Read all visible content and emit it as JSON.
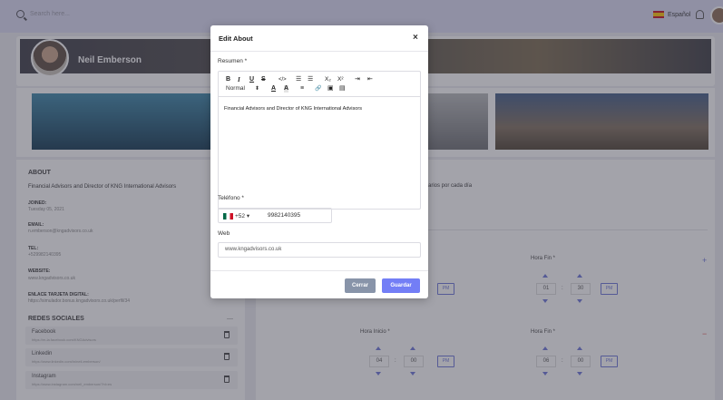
{
  "topbar": {
    "search_placeholder": "Search here...",
    "language": "Español"
  },
  "profile": {
    "name": "Neil Emberson"
  },
  "about": {
    "title": "ABOUT",
    "description": "Financial Advisors and Director of KNG International Advisors",
    "fields": [
      {
        "label": "JOINED:",
        "value": "Tuesday 05, 2021"
      },
      {
        "label": "EMAIL:",
        "value": "n.emberson@kngadvisors.co.uk"
      },
      {
        "label": "TEL:",
        "value": "+529982140395"
      },
      {
        "label": "WEBSITE:",
        "value": "www.kngadvisors.co.uk"
      },
      {
        "label": "ENLACE TARJETA DIGITAL:",
        "value": "https://simulador.bonus.kngadvisors.co.uk/perfil/34"
      }
    ],
    "social_title": "REDES SOCIALES",
    "social_more": "—",
    "social": [
      {
        "name": "Facebook",
        "url": "https://m-la.facebook.com/KNGAdvisors"
      },
      {
        "name": "Linkedin",
        "url": "https://www.linkedin.com/in/neil-emberson/"
      },
      {
        "name": "Instagram",
        "url": "https://www.instagram.com/neil_emberson/?hl=es"
      }
    ]
  },
  "hours": {
    "partial_text": "rarios por cada día",
    "rows": [
      {
        "start_label": "",
        "start_hour": "",
        "start_min": "",
        "start_ampm": "PM",
        "end_label": "Hora Fin *",
        "end_hour": "01",
        "end_min": "30",
        "end_ampm": "PM",
        "action": "+"
      },
      {
        "start_label": "Hora Inicio *",
        "start_hour": "04",
        "start_min": "00",
        "start_ampm": "PM",
        "end_label": "Hora Fin *",
        "end_hour": "06",
        "end_min": "00",
        "end_ampm": "PM",
        "action": "−"
      }
    ]
  },
  "modal": {
    "title": "Edit About",
    "close": "×",
    "resumen_label": "Resumen *",
    "toolbar": {
      "bold": "B",
      "italic": "I",
      "underline": "U",
      "strike": "S",
      "code": "</>",
      "ordered_list": "☰",
      "bullet_list": "☰",
      "subscript": "X₂",
      "superscript": "X²",
      "indent": "⇥",
      "outdent": "⇤",
      "style": "Normal",
      "style_caret": "⬍",
      "font_color": "A",
      "highlight": "A",
      "align": "≡",
      "link": "🔗",
      "image": "▣",
      "video": "▤"
    },
    "resumen_value": "Financial Advisors and Director of KNG International Advisors",
    "telefono_label": "Teléfono *",
    "dial_code": "+52 ▾",
    "phone": "9982140395",
    "web_label": "Web",
    "web_value": "www.kngadvisors.co.uk",
    "cerrar": "Cerrar",
    "guardar": "Guardar"
  }
}
